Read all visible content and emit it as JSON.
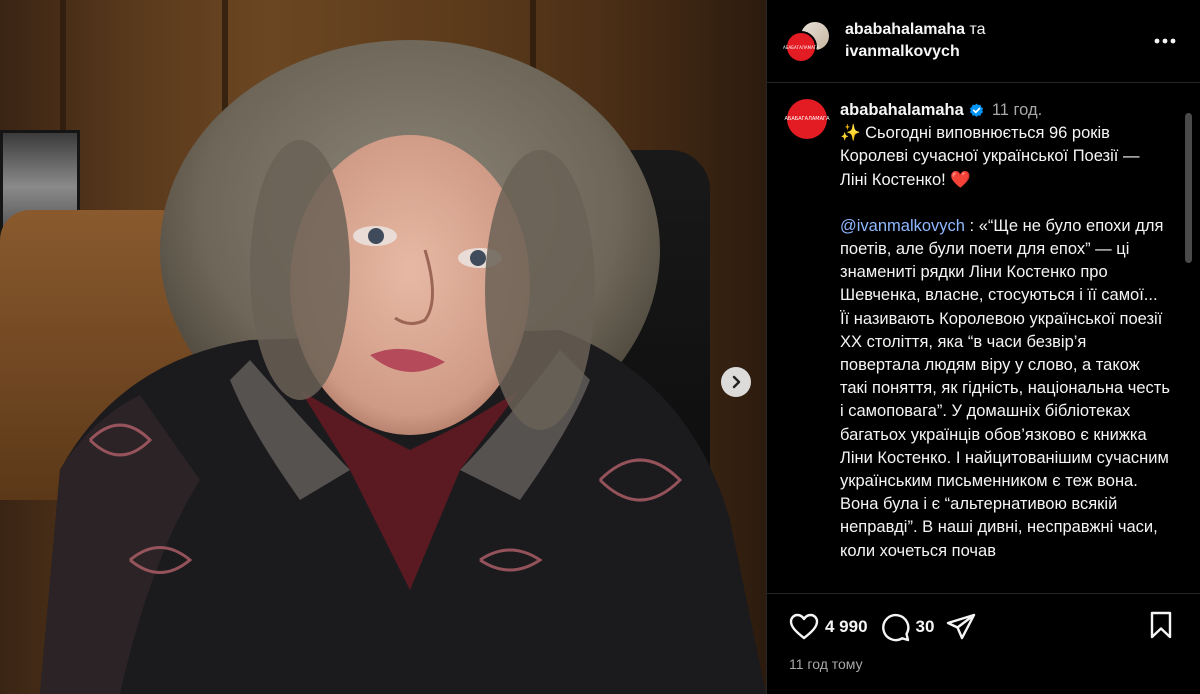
{
  "header": {
    "user1": "ababahalamaha",
    "conjunction": "та",
    "user2": "ivanmalkovych",
    "more_icon": "more-horizontal-icon"
  },
  "avatar_text": "АБАБАГАЛАМАГА",
  "caption": {
    "author": "ababahalamaha",
    "time_ago": "11 год.",
    "intro": "✨ Сьогодні виповнюється 96 років Королеві сучасної української Поезії — Ліні Костенко! ❤️",
    "mention": "@ivanmalkovych",
    "body": " : «“Ще не було епохи для поетів, але були поети для епох” — ці знамениті рядки Ліни Костенко про Шевченка, власне, стосуються і її самої... Її називають Королевою української поезії XX століття, яка “в часи безвір’я повертала людям віру у слово, а також такі поняття, як гідність, національна честь і самоповага”. У домашніх бібліотеках багатьох українців обов’язково є книжка Ліни Костенко. І найцитованішим сучасним українським письменником є теж вона. Вона була і є “альтернативою всякій неправді”. В наші дивні, несправжні часи, коли хочеться почав"
  },
  "actions": {
    "likes": "4 990",
    "comments": "30",
    "like_icon": "heart-icon",
    "comment_icon": "comment-icon",
    "share_icon": "share-icon",
    "save_icon": "bookmark-icon"
  },
  "footer": {
    "posted": "11 год тому"
  },
  "colors": {
    "brand": "#e31b23",
    "verified": "#0095f6",
    "mention": "#8fb8ff"
  }
}
